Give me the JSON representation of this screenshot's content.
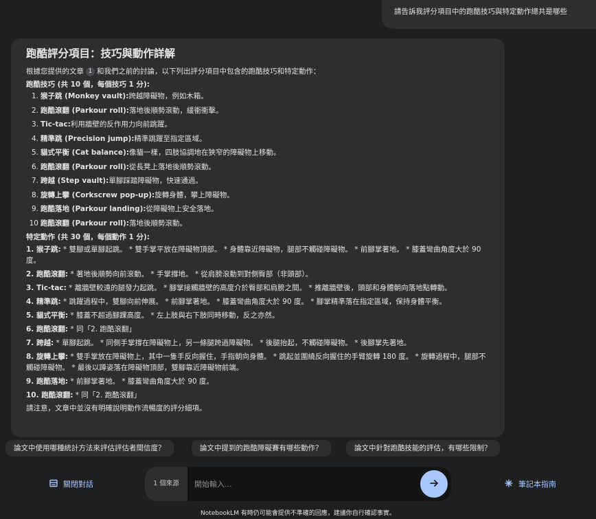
{
  "user_query": "請告訴我評分項目中的跑酷技巧與特定動作總共是哪些",
  "answer": {
    "title": "跑酷評分項目：技巧與動作詳解",
    "intro_before": "根據您提供的文章",
    "citation": "1",
    "intro_after": "和我們之前的討論，以下列出評分項目中包含的跑酷技巧和特定動作：",
    "skills_heading": "跑酷技巧 (共 10 個，每個技巧 1 分):",
    "skills": [
      {
        "num": "1.",
        "name": "猴子跳 (Monkey vault):",
        "desc": " 跨越障礙物，例如木箱。"
      },
      {
        "num": "2.",
        "name": "跑酷滾翻 (Parkour roll):",
        "desc": " 落地後順勢滾動，緩衝衝擊。"
      },
      {
        "num": "3.",
        "name": "Tic-tac:",
        "desc": " 利用牆壁的反作用力向前跳躍。"
      },
      {
        "num": "4.",
        "name": "精準跳 (Precision jump):",
        "desc": " 精準跳躍至指定區域。"
      },
      {
        "num": "5.",
        "name": "貓式平衡 (Cat balance):",
        "desc": " 像貓一樣，四肢協調地在狹窄的障礙物上移動。"
      },
      {
        "num": "6.",
        "name": "跑酷滾翻 (Parkour roll):",
        "desc": " 從長凳上落地後順勢滾動。"
      },
      {
        "num": "7.",
        "name": "跨越 (Step vault):",
        "desc": " 單腳踩踏障礙物，快速通過。"
      },
      {
        "num": "8.",
        "name": "旋轉上攀 (Corkscrew pop-up):",
        "desc": " 旋轉身體，攀上障礙物。"
      },
      {
        "num": "9.",
        "name": "跑酷落地 (Parkour landing):",
        "desc": " 從障礙物上安全落地。"
      },
      {
        "num": "10",
        "name": "跑酷滾翻 (Parkour roll):",
        "desc": " 落地後順勢滾動。"
      }
    ],
    "moves_heading": "特定動作 (共 30 個，每個動作 1 分):",
    "moves": [
      {
        "name": "1. 猴子跳:",
        "desc": " * 雙腳或單腳起跳。 * 雙手掌平放在障礙物頂部。 * 身體靠近障礙物，腿部不觸碰障礙物。 * 前腳掌著地。 * 膝蓋彎曲角度大於 90 度。"
      },
      {
        "name": "2. 跑酷滾翻:",
        "desc": " * 著地後順勢向前滾動。 * 手掌撐地。 * 從肩膀滾動到對側臀部（非頭部）。"
      },
      {
        "name": "3. Tic-tac:",
        "desc": " * 離牆壁較遠的腿發力起跳。 * 腳掌接觸牆壁的高度介於臀部和肩膀之間。 * 推離牆壁後，頭部和身體朝向落地點轉動。"
      },
      {
        "name": "4. 精準跳:",
        "desc": " * 跳躍過程中，雙腳向前伸展。 * 前腳掌著地。 * 膝蓋彎曲角度大於 90 度。 * 腳掌精準落在指定區域，保持身體平衡。"
      },
      {
        "name": "5. 貓式平衡:",
        "desc": " * 膝蓋不超過腳踝高度。 * 左上肢與右下肢同時移動，反之亦然。"
      },
      {
        "name": "6. 跑酷滾翻:",
        "desc": " * 同「2. 跑酷滾翻」"
      },
      {
        "name": "7. 跨越:",
        "desc": " * 單腳起跳。 * 同側手掌撐在障礙物上，另一條腿跨過障礙物。 * 後腿抬起，不觸碰障礙物。 * 後腳掌先著地。"
      },
      {
        "name": "8. 旋轉上攀:",
        "desc": " * 雙手掌放在障礙物上，其中一隻手反向握住，手指朝向身體。 * 跳起並圍繞反向握住的手臂旋轉 180 度。 * 旋轉過程中，腿部不觸碰障礙物。 * 最後以蹲姿落在障礙物頂部，雙腳靠近障礙物前端。"
      },
      {
        "name": "9. 跑酷落地:",
        "desc": " * 前腳掌著地。 * 膝蓋彎曲角度大於 90 度。"
      },
      {
        "name": "10. 跑酷滾翻:",
        "desc": " * 同「2. 跑酷滾翻」"
      }
    ],
    "outro": "請注意，文章中並沒有明確說明動作流暢度的評分細項。"
  },
  "suggestions": [
    "論文中使用哪種統計方法來評估評估者間信度？",
    "論文中提到的跑酷障礙賽有哪些動作？",
    "論文中針對跑酷技能的評估，有哪些限制？"
  ],
  "bottom_bar": {
    "close_chat_label": "關閉對話",
    "close_chat_icon": "panel-icon",
    "source_count": "1 個來源",
    "input_placeholder": "開始輸入...",
    "send_icon": "arrow-right-icon",
    "notebook_guide_label": "筆記本指南",
    "notebook_guide_icon": "sparkle-icon"
  },
  "disclaimer": "NotebookLM 有時仍可能會提供不準確的回應，建議你自行確認事實。",
  "colors": {
    "background": "#1e1f20",
    "card": "#2d2e30",
    "accent": "#a8c7fa",
    "text": "#e3e3e3"
  }
}
